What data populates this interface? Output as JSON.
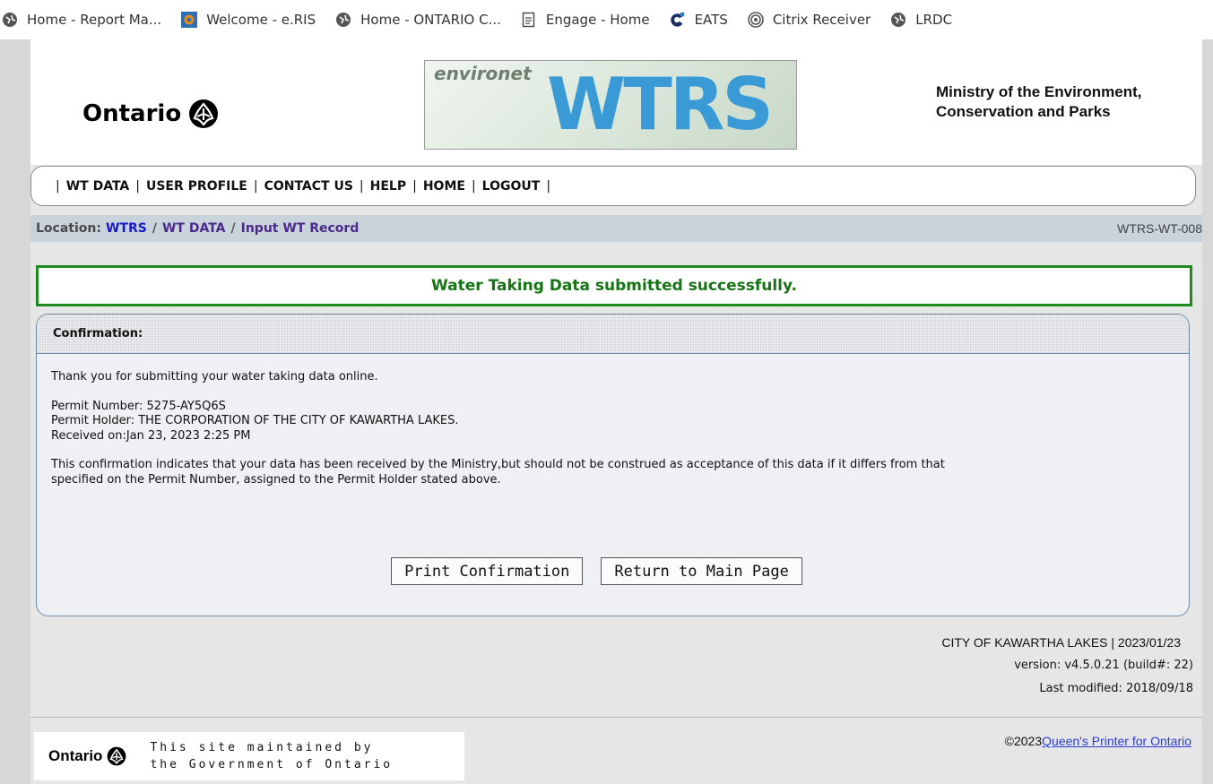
{
  "bookmarks": [
    {
      "label": "Home - Report Ma...",
      "icon": "globe-icon"
    },
    {
      "label": "Welcome - e.RIS",
      "icon": "eris-icon"
    },
    {
      "label": "Home - ONTARIO C...",
      "icon": "globe-icon"
    },
    {
      "label": "Engage - Home",
      "icon": "document-icon"
    },
    {
      "label": "EATS",
      "icon": "eats-icon"
    },
    {
      "label": "Citrix Receiver",
      "icon": "citrix-icon"
    },
    {
      "label": "LRDC",
      "icon": "globe-icon"
    }
  ],
  "header": {
    "ontario_word": "Ontario",
    "banner_small": "environet",
    "banner_big": "WTRS",
    "ministry_line1": "Ministry of the Environment,",
    "ministry_line2": "Conservation and Parks"
  },
  "nav": {
    "items": [
      "WT DATA",
      "USER PROFILE",
      "CONTACT US",
      "HELP",
      "HOME",
      "LOGOUT"
    ]
  },
  "location": {
    "label": "Location:",
    "crumbs": [
      "WTRS",
      "WT DATA",
      "Input WT Record"
    ],
    "page_code": "WTRS-WT-008"
  },
  "success_message": "Water Taking Data submitted successfully.",
  "confirmation": {
    "title": "Confirmation:",
    "thanks": "Thank you for submitting your water taking data online.",
    "permit_number": "Permit Number: 5275-AY5Q6S",
    "permit_holder": "Permit Holder: THE CORPORATION OF THE CITY OF KAWARTHA LAKES.",
    "received_on": "Received on:Jan 23, 2023 2:25 PM",
    "notice_line1": "This confirmation indicates that your data has been received by the Ministry,but should not be construed as acceptance of this data if it differs from that",
    "notice_line2": "specified on the Permit Number, assigned to the Permit Holder stated above.",
    "print_button": "Print Confirmation",
    "return_button": "Return to Main Page"
  },
  "meta": {
    "org_date": "CITY OF KAWARTHA LAKES | 2023/01/23",
    "version": "version: v4.5.0.21 (build#: 22)",
    "last_modified": "Last modified: 2018/09/18"
  },
  "footer": {
    "ontario_word": "Ontario",
    "maintained_line1": "This site maintained by",
    "maintained_line2": "the Government of Ontario",
    "copyright_prefix": "©2023",
    "copyright_link": "Queen's Printer for Ontario"
  },
  "colors": {
    "success_green": "#1f8a1f",
    "wtrs_blue": "#3a9ad6",
    "location_bg": "#c9d3dc",
    "link_blue": "#1a1acc"
  }
}
